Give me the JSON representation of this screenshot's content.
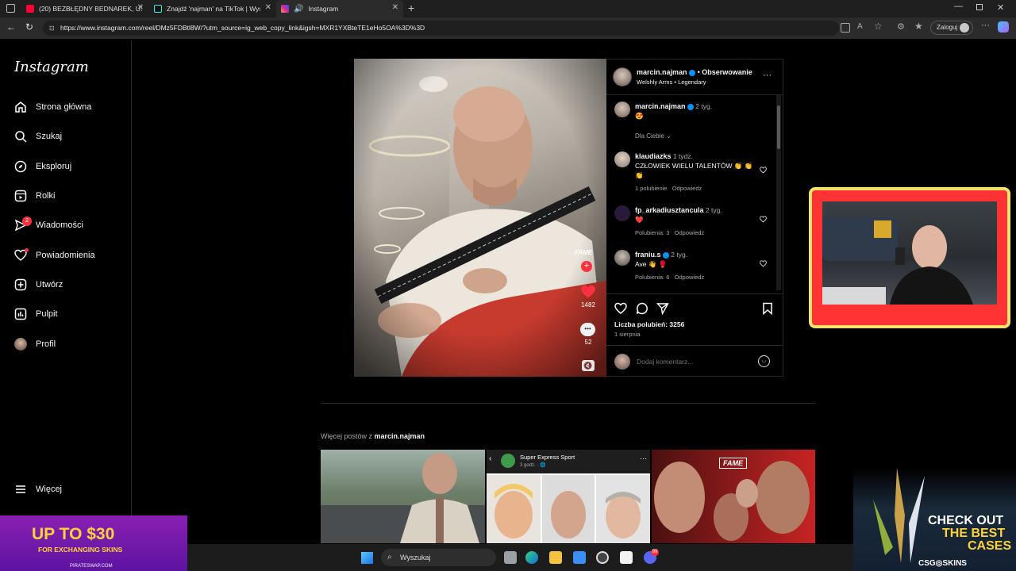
{
  "browser": {
    "tabs": [
      {
        "title": "(20) BEZBŁĘDNY BEDNAREK, USP..."
      },
      {
        "title": "Znajdź 'najman' na TikTok | Wyszuk..."
      },
      {
        "title": "Instagram"
      }
    ],
    "url": "https://www.instagram.com/reel/DMz5FDBtl8W/?utm_source=ig_web_copy_link&igsh=MXR1YXBteTE1eHo5OA%3D%3D",
    "signin_label": "Zaloguj"
  },
  "instagram": {
    "logo": "Instagram",
    "nav": [
      {
        "label": "Strona główna",
        "icon": "home-icon"
      },
      {
        "label": "Szukaj",
        "icon": "search-icon"
      },
      {
        "label": "Eksploruj",
        "icon": "compass-icon"
      },
      {
        "label": "Rolki",
        "icon": "reels-icon"
      },
      {
        "label": "Wiadomości",
        "icon": "messenger-icon"
      },
      {
        "label": "Powiadomienia",
        "icon": "heart-icon"
      },
      {
        "label": "Utwórz",
        "icon": "plus-icon"
      },
      {
        "label": "Pulpit",
        "icon": "dashboard-icon"
      },
      {
        "label": "Profil",
        "icon": "avatar-icon"
      }
    ],
    "messages_badge": "2",
    "more_label": "Więcej"
  },
  "post": {
    "username": "marcin.najman",
    "follow_label": "Obserwowanie",
    "audio": "Welshly Arms • Legendary",
    "video_overlay": {
      "likes": "1482",
      "comments": "52",
      "watermark": "FAME"
    },
    "caption": {
      "user": "marcin.najman",
      "time": "2 tyg.",
      "text": "😍"
    },
    "filter_label": "Dla Ciebie",
    "comments": [
      {
        "user": "klaudiazks",
        "time": "1 tydz.",
        "text": "CZŁOWIEK WIELU TALENTÓW 👏 👏 👏",
        "likes": "1 polubienie",
        "reply": "Odpowiedz"
      },
      {
        "user": "fp_arkadiusztancula",
        "time": "2 tyg.",
        "text": "❤️",
        "likes": "Polubienia: 3",
        "reply": "Odpowiedz"
      },
      {
        "user": "franiu.s",
        "time": "2 tyg.",
        "text": "Ave 👋 🥊",
        "likes": "Polubienia: 6",
        "reply": "Odpowiedz"
      }
    ],
    "likes_count": "Liczba polubień: 3256",
    "date": "1 sierpnia",
    "comment_placeholder": "Dodaj komentarz..."
  },
  "more_posts": {
    "prefix": "Więcej postów z ",
    "user": "marcin.najman",
    "tile2_title": "Super Express Sport",
    "tile2_time": "3 godz. · 🌐",
    "tile3_logo": "FAME"
  },
  "overlays": {
    "ad_left_big": "UP TO $30",
    "ad_left_small": "FOR EXCHANGING SKINS",
    "ad_left_brand": "PIRATESWAP.COM",
    "ad_right_line1": "CHECK OUT",
    "ad_right_line2": "THE BEST",
    "ad_right_line3": "CASES",
    "ad_right_brand": "CSG◎SKINS"
  },
  "taskbar": {
    "search_label": "Wyszukaj",
    "discord_badge": "99"
  }
}
